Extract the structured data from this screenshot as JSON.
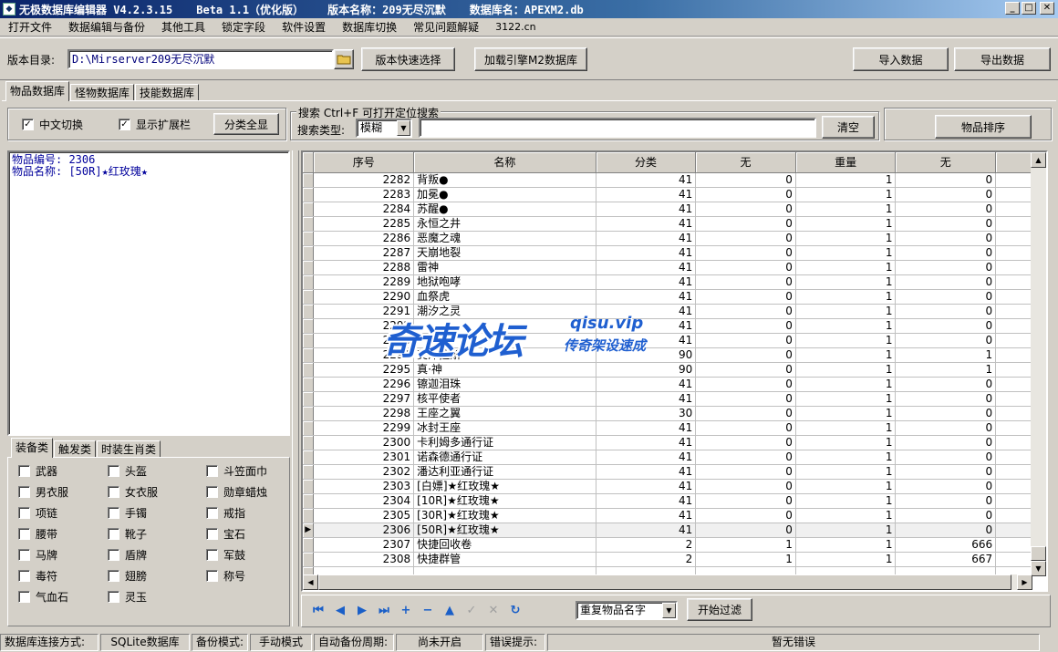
{
  "titlebar": {
    "app": "无极数据库编辑器 V4.2.3.15",
    "edition": "Beta 1.1（优化版）",
    "version_name": "版本名称：209无尽沉默",
    "db_name": "数据库名：APEXM2.db"
  },
  "menu": [
    "打开文件",
    "数据编辑与备份",
    "其他工具",
    "锁定字段",
    "软件设置",
    "数据库切换",
    "常见问题解疑",
    "3122.cn"
  ],
  "toolbar": {
    "dir_label": "版本目录:",
    "dir_value": "D:\\Mirserver209无尽沉默",
    "quick_select": "版本快速选择",
    "load_engine": "加载引擎M2数据库",
    "import": "导入数据",
    "export": "导出数据"
  },
  "tabs": [
    "物品数据库",
    "怪物数据库",
    "技能数据库"
  ],
  "options": {
    "chinese_switch": "中文切换",
    "show_ext": "显示扩展栏",
    "show_all_cat": "分类全显"
  },
  "search": {
    "legend": "搜索  Ctrl+F 可打开定位搜索",
    "type_label": "搜索类型:",
    "type_value": "模糊",
    "query": "",
    "clear": "清空",
    "sort": "物品排序"
  },
  "info": {
    "line1": "物品编号: 2306",
    "line2": "物品名称: [50R]★红玫瑰★"
  },
  "category_tabs": [
    "装备类",
    "触发类",
    "时装生肖类"
  ],
  "categories": [
    [
      "武器",
      "头盔",
      "斗笠面巾"
    ],
    [
      "男衣服",
      "女衣服",
      "勋章蜡烛"
    ],
    [
      "项链",
      "手镯",
      "戒指"
    ],
    [
      "腰带",
      "靴子",
      "宝石"
    ],
    [
      "马牌",
      "盾牌",
      "军鼓"
    ],
    [
      "毒符",
      "翅膀",
      "称号"
    ],
    [
      "气血石",
      "灵玉",
      ""
    ]
  ],
  "grid": {
    "headers": [
      "序号",
      "名称",
      "分类",
      "无",
      "重量",
      "无"
    ],
    "selected_row": "2306",
    "rows": [
      [
        "2282",
        "背叛●",
        "41",
        "0",
        "1",
        "0"
      ],
      [
        "2283",
        "加冕●",
        "41",
        "0",
        "1",
        "0"
      ],
      [
        "2284",
        "苏醒●",
        "41",
        "0",
        "1",
        "0"
      ],
      [
        "2285",
        "永恒之井",
        "41",
        "0",
        "1",
        "0"
      ],
      [
        "2286",
        "恶魔之魂",
        "41",
        "0",
        "1",
        "0"
      ],
      [
        "2287",
        "天崩地裂",
        "41",
        "0",
        "1",
        "0"
      ],
      [
        "2288",
        "雷神",
        "41",
        "0",
        "1",
        "0"
      ],
      [
        "2289",
        "地狱咆哮",
        "41",
        "0",
        "1",
        "0"
      ],
      [
        "2290",
        "血祭虎",
        "41",
        "0",
        "1",
        "0"
      ],
      [
        "2291",
        "潮汐之灵",
        "41",
        "0",
        "1",
        "0"
      ],
      [
        "2292",
        "",
        "41",
        "0",
        "1",
        "0"
      ],
      [
        "2293",
        "",
        "41",
        "0",
        "1",
        "0"
      ],
      [
        "2294",
        "艾泽拉斯",
        "90",
        "0",
        "1",
        "1"
      ],
      [
        "2295",
        "真·神",
        "90",
        "0",
        "1",
        "1"
      ],
      [
        "2296",
        "镲迦泪珠",
        "41",
        "0",
        "1",
        "0"
      ],
      [
        "2297",
        "核平使者",
        "41",
        "0",
        "1",
        "0"
      ],
      [
        "2298",
        "王座之翼",
        "30",
        "0",
        "1",
        "0"
      ],
      [
        "2299",
        "冰封王座",
        "41",
        "0",
        "1",
        "0"
      ],
      [
        "2300",
        "卡利姆多通行证",
        "41",
        "0",
        "1",
        "0"
      ],
      [
        "2301",
        "诺森德通行证",
        "41",
        "0",
        "1",
        "0"
      ],
      [
        "2302",
        "潘达利亚通行证",
        "41",
        "0",
        "1",
        "0"
      ],
      [
        "2303",
        "[白嫖]★红玫瑰★",
        "41",
        "0",
        "1",
        "0"
      ],
      [
        "2304",
        "[10R]★红玫瑰★",
        "41",
        "0",
        "1",
        "0"
      ],
      [
        "2305",
        "[30R]★红玫瑰★",
        "41",
        "0",
        "1",
        "0"
      ],
      [
        "2306",
        "[50R]★红玫瑰★",
        "41",
        "0",
        "1",
        "0"
      ],
      [
        "2307",
        "快捷回收卷",
        "2",
        "1",
        "1",
        "666"
      ],
      [
        "2308",
        "快捷群管",
        "2",
        "1",
        "1",
        "667"
      ]
    ]
  },
  "nav": {
    "filter_value": "重复物品名字",
    "filter_button": "开始过滤"
  },
  "status": {
    "conn_label": "数据库连接方式:",
    "conn_value": "SQLite数据库",
    "backup_label": "备份模式:",
    "backup_value": "手动模式",
    "auto_label": "自动备份周期:",
    "auto_value": "尚未开启",
    "error_label": "错误提示:",
    "error_value": "暂无错误"
  },
  "watermark": {
    "big": "奇速论坛",
    "url": "qisu.vip",
    "sub": "传奇架设速成"
  }
}
